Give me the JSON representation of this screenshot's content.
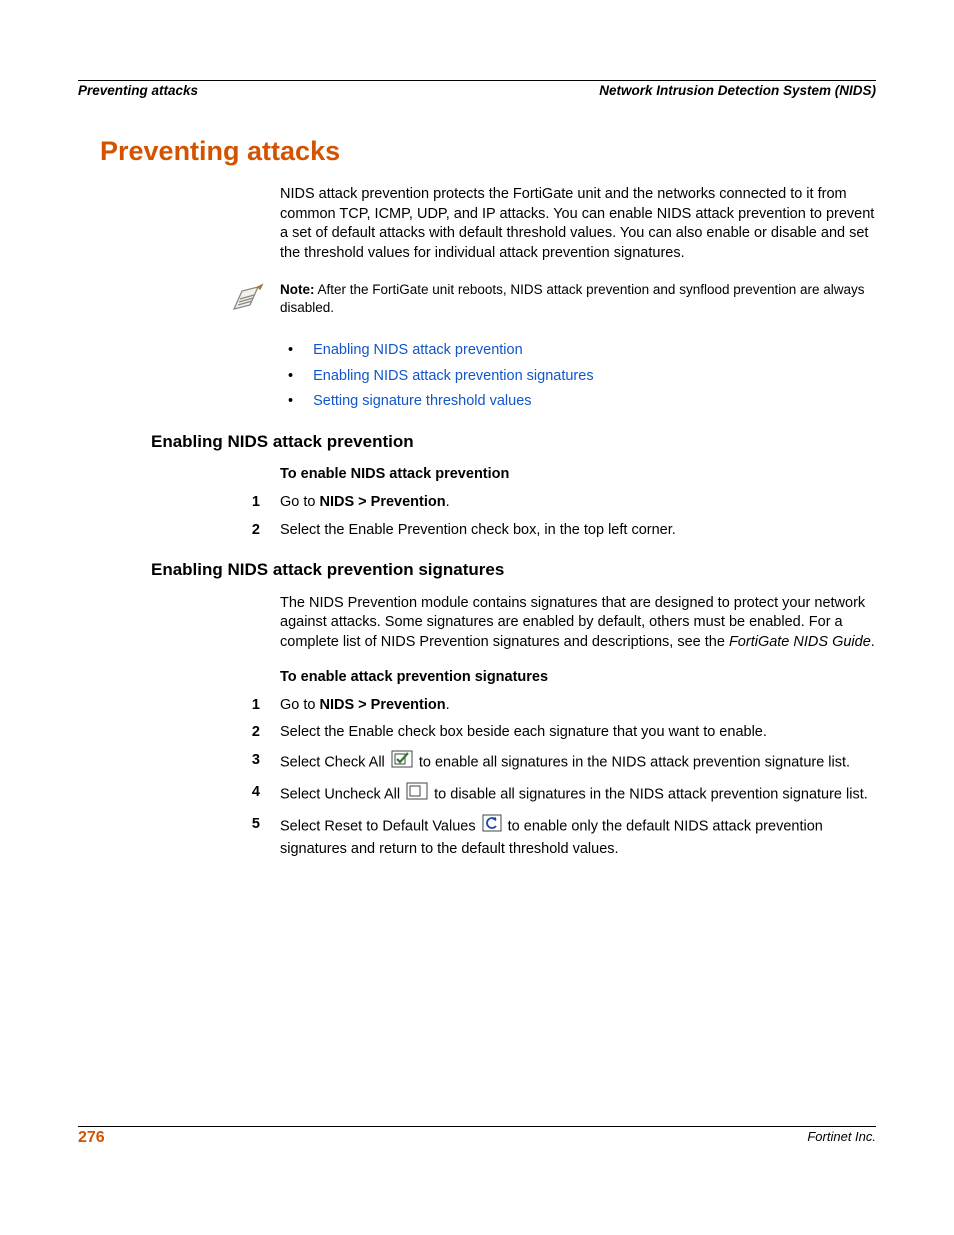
{
  "header": {
    "left": "Preventing attacks",
    "right": "Network Intrusion Detection System (NIDS)"
  },
  "title": "Preventing attacks",
  "intro": "NIDS attack prevention protects the FortiGate unit and the networks connected to it from common TCP, ICMP, UDP, and IP attacks. You can enable NIDS attack prevention to prevent a set of default attacks with default threshold values. You can also enable or disable and set the threshold values for individual attack prevention signatures.",
  "note": {
    "label": "Note:",
    "text": " After the FortiGate unit reboots, NIDS attack prevention and synflood prevention are always disabled."
  },
  "links": [
    "Enabling NIDS attack prevention",
    "Enabling NIDS attack prevention signatures",
    "Setting signature threshold values"
  ],
  "section1": {
    "heading": "Enabling NIDS attack prevention",
    "procTitle": "To enable NIDS attack prevention",
    "steps": {
      "s1a": "Go to ",
      "s1b": "NIDS > Prevention",
      "s1c": ".",
      "s2": "Select the Enable Prevention check box, in the top left corner."
    }
  },
  "section2": {
    "heading": "Enabling NIDS attack prevention signatures",
    "intro_a": "The NIDS Prevention module contains signatures that are designed to protect your network against attacks. Some signatures are enabled by default, others must be enabled. For a complete list of NIDS Prevention signatures and descriptions, see the ",
    "intro_italic": "FortiGate NIDS Guide",
    "intro_b": ".",
    "procTitle": "To enable attack prevention signatures",
    "steps": {
      "s1a": "Go to ",
      "s1b": "NIDS > Prevention",
      "s1c": ".",
      "s2": "Select the Enable check box beside each signature that you want to enable.",
      "s3a": "Select Check All ",
      "s3b": " to enable all signatures in the NIDS attack prevention signature list.",
      "s4a": "Select Uncheck All ",
      "s4b": " to disable all signatures in the NIDS attack prevention signature list.",
      "s5a": "Select Reset to Default Values ",
      "s5b": " to enable only the default NIDS attack prevention signatures and return to the default threshold values."
    }
  },
  "footer": {
    "page": "276",
    "right": "Fortinet Inc."
  },
  "nums": {
    "n1": "1",
    "n2": "2",
    "n3": "3",
    "n4": "4",
    "n5": "5"
  },
  "bullet": "•"
}
